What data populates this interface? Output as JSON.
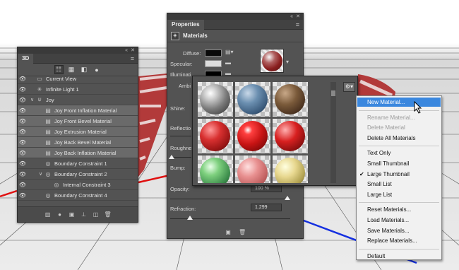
{
  "colors": {
    "panel_bg": "#535353",
    "menu_highlight": "#3a87de",
    "axis_red": "#e01010",
    "axis_blue": "#1530e0"
  },
  "panel_3d": {
    "title": "3D",
    "toolbar_icons": [
      "scene-filter-icon",
      "mesh-filter-icon",
      "material-filter-icon",
      "light-filter-icon"
    ],
    "tree": [
      {
        "label": "Current View",
        "icon": "camera-icon",
        "indent": 0,
        "twisty": "",
        "selected": false
      },
      {
        "label": "Infinite Light 1",
        "icon": "light-icon",
        "indent": 0,
        "twisty": "",
        "selected": false
      },
      {
        "label": "Joy",
        "icon": "mesh-icon",
        "indent": 0,
        "twisty": "∨",
        "selected": false
      },
      {
        "label": "Joy Front Inflation Material",
        "icon": "material-icon",
        "indent": 1,
        "twisty": "",
        "selected": true
      },
      {
        "label": "Joy Front Bevel Material",
        "icon": "material-icon",
        "indent": 1,
        "twisty": "",
        "selected": true
      },
      {
        "label": "Joy Extrusion Material",
        "icon": "material-icon",
        "indent": 1,
        "twisty": "",
        "selected": true
      },
      {
        "label": "Joy Back Bevel Material",
        "icon": "material-icon",
        "indent": 1,
        "twisty": "",
        "selected": true
      },
      {
        "label": "Joy Back Inflation Material",
        "icon": "material-icon",
        "indent": 1,
        "twisty": "",
        "selected": true
      },
      {
        "label": "Boundary Constraint 1",
        "icon": "constraint-icon",
        "indent": 1,
        "twisty": "",
        "selected": false
      },
      {
        "label": "Boundary Constraint 2",
        "icon": "constraint-icon",
        "indent": 1,
        "twisty": "∨",
        "selected": false
      },
      {
        "label": "Internal Constraint 3",
        "icon": "constraint-icon",
        "indent": 2,
        "twisty": "",
        "selected": false
      },
      {
        "label": "Boundary Constraint 4",
        "icon": "constraint-icon",
        "indent": 1,
        "twisty": "",
        "selected": false
      }
    ],
    "bottom_icons": [
      "trash-scene-icon",
      "add-light-icon",
      "render-icon",
      "ground-icon",
      "new-mesh-icon",
      "delete-icon"
    ]
  },
  "panel_props": {
    "title": "Properties",
    "section": "Materials",
    "labels": {
      "diffuse": "Diffuse:",
      "specular": "Specular:",
      "illumination": "Illuminati",
      "ambient": "Ambi",
      "shine": "Shine:",
      "reflection": "Reflectio",
      "roughness": "Roughne",
      "bump": "Bump:",
      "opacity": "Opacity:",
      "refraction": "Refraction:"
    },
    "opacity_value": "100 %",
    "refraction_value": "1.299"
  },
  "material_picker": {
    "materials": [
      {
        "name": "metal-silver"
      },
      {
        "name": "plastic-blue"
      },
      {
        "name": "wood"
      },
      {
        "name": "red-fabric"
      },
      {
        "name": "red-glossy"
      },
      {
        "name": "red-fabric-fine"
      },
      {
        "name": "green-glass"
      },
      {
        "name": "pink-glass"
      },
      {
        "name": "yellow-glass"
      }
    ]
  },
  "context_menu": {
    "items": [
      {
        "label": "New Material...",
        "state": "highlighted",
        "checked": false
      },
      {
        "sep": true
      },
      {
        "label": "Rename Material...",
        "state": "disabled",
        "checked": false
      },
      {
        "label": "Delete Material",
        "state": "disabled",
        "checked": false
      },
      {
        "label": "Delete All Materials",
        "state": "normal",
        "checked": false
      },
      {
        "sep": true
      },
      {
        "label": "Text Only",
        "state": "normal",
        "checked": false
      },
      {
        "label": "Small Thumbnail",
        "state": "normal",
        "checked": false
      },
      {
        "label": "Large Thumbnail",
        "state": "normal",
        "checked": true
      },
      {
        "label": "Small List",
        "state": "normal",
        "checked": false
      },
      {
        "label": "Large List",
        "state": "normal",
        "checked": false
      },
      {
        "sep": true
      },
      {
        "label": "Reset Materials...",
        "state": "normal",
        "checked": false
      },
      {
        "label": "Load Materials...",
        "state": "normal",
        "checked": false
      },
      {
        "label": "Save Materials...",
        "state": "normal",
        "checked": false
      },
      {
        "label": "Replace Materials...",
        "state": "normal",
        "checked": false
      },
      {
        "sep": true
      },
      {
        "label": "Default",
        "state": "normal",
        "checked": false
      }
    ]
  }
}
